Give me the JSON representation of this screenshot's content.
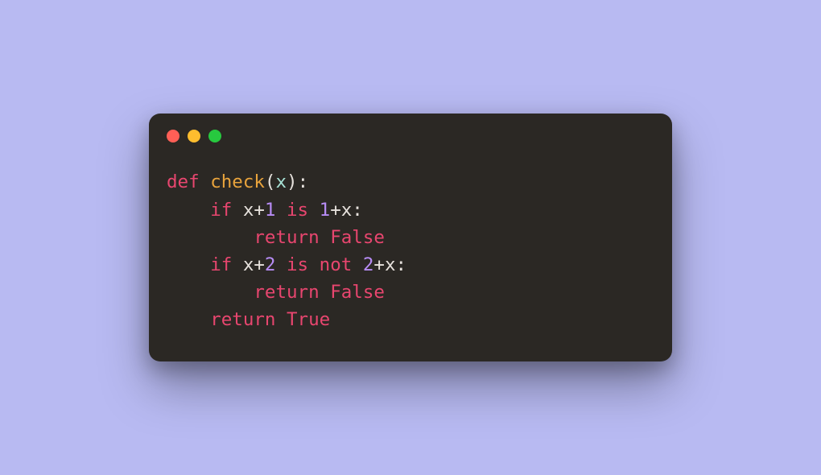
{
  "window": {
    "trafficLights": {
      "red": "red",
      "yellow": "yellow",
      "green": "green"
    }
  },
  "code": {
    "tokens": {
      "def": "def",
      "fnName": "check",
      "lparen": "(",
      "param": "x",
      "rparen": ")",
      "colon": ":",
      "if": "if",
      "var_x": "x",
      "plus": "+",
      "num1": "1",
      "is": "is",
      "num2": "2",
      "not": "not",
      "return": "return",
      "false": "False",
      "true": "True",
      "space": " "
    },
    "raw": "def check(x):\n    if x+1 is 1+x:\n        return False\n    if x+2 is not 2+x:\n        return False\n    return True"
  }
}
